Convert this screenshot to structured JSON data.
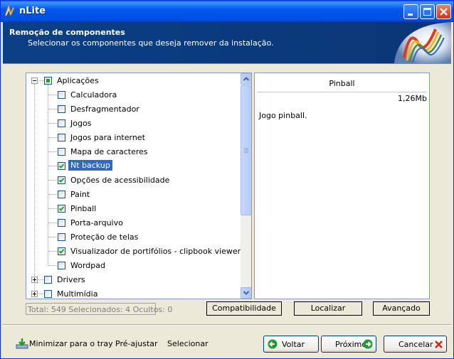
{
  "window": {
    "title": "nLite"
  },
  "header": {
    "title": "Remoção de componentes",
    "subtitle": "Selecionar os componentes que deseja remover da instalação."
  },
  "tree": {
    "groups": [
      {
        "label": "Aplicações",
        "expanded": true,
        "state": "partial"
      },
      {
        "label": "Drivers",
        "expanded": false,
        "state": "unchecked"
      },
      {
        "label": "Multimídia",
        "expanded": false,
        "state": "unchecked"
      }
    ],
    "items": [
      {
        "label": "Calculadora",
        "checked": false
      },
      {
        "label": "Desfragmentador",
        "checked": false
      },
      {
        "label": "Jogos",
        "checked": false
      },
      {
        "label": "Jogos para internet",
        "checked": false
      },
      {
        "label": "Mapa de caracteres",
        "checked": false
      },
      {
        "label": "Nt backup",
        "checked": true,
        "selected": true
      },
      {
        "label": "Opções de acessibilidade",
        "checked": true
      },
      {
        "label": "Paint",
        "checked": false
      },
      {
        "label": "Pinball",
        "checked": true
      },
      {
        "label": "Porta-arquivo",
        "checked": false
      },
      {
        "label": "Proteção de telas",
        "checked": false
      },
      {
        "label": "Visualizador de portifólios - clipbook viewer",
        "checked": true
      },
      {
        "label": "Wordpad",
        "checked": false
      }
    ]
  },
  "info": {
    "title": "Pinball",
    "size": "1,26Mb",
    "description": "Jogo pinball."
  },
  "status": {
    "text": "Total: 549 Selecionados: 4 Ocultos: 0"
  },
  "toolbar": {
    "compat_label": "Compatibilidade",
    "find_label": "Localizar",
    "advanced_label": "Avançado"
  },
  "footer": {
    "tray_label": "Minimizar para o tray",
    "preset_label": "Pré-ajustar",
    "select_label": "Selecionar",
    "back_label": "Voltar",
    "next_label": "Próximo",
    "cancel_label": "Cancelar"
  },
  "colors": {
    "titlebar": "#0058EE",
    "header_bg": "#0A3A7C",
    "selection": "#316AC5",
    "check": "#21A121"
  }
}
